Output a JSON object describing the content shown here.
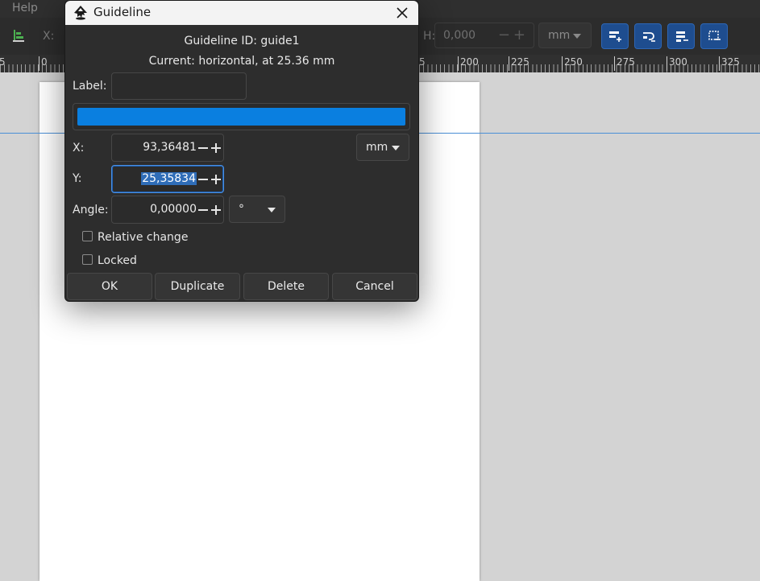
{
  "menubar": {
    "help_label": "Help"
  },
  "toolbar": {
    "x_label": "X:",
    "h_label": "H:",
    "h_value": "0,000",
    "unit": "mm",
    "snap_button_icons": [
      "snap-align-icon",
      "snap-rotate-icon",
      "snap-distribute-icon",
      "snap-select-icon"
    ]
  },
  "ruler": {
    "marks": [
      "5",
      "0",
      "5",
      "200",
      "225",
      "250",
      "275",
      "300",
      "325"
    ]
  },
  "dialog": {
    "title": "Guideline",
    "guideline_id": "Guideline ID: guide1",
    "current": "Current: horizontal, at 25.36 mm",
    "label_label": "Label:",
    "label_value": "",
    "color": "#0a7fe0",
    "x_label": "X:",
    "x_value": "93,36481",
    "y_label": "Y:",
    "y_value": "25,35834",
    "angle_label": "Angle:",
    "angle_value": "0,00000",
    "unit": "mm",
    "angle_unit": "°",
    "relative_change_label": "Relative change",
    "relative_change_checked": false,
    "locked_label": "Locked",
    "locked_checked": false,
    "buttons": {
      "ok": "OK",
      "duplicate": "Duplicate",
      "delete": "Delete",
      "cancel": "Cancel"
    }
  },
  "colors": {
    "accent": "#0a7fe0",
    "guide_line": "#4a8fd6",
    "snap_button": "#1e4d8f"
  }
}
